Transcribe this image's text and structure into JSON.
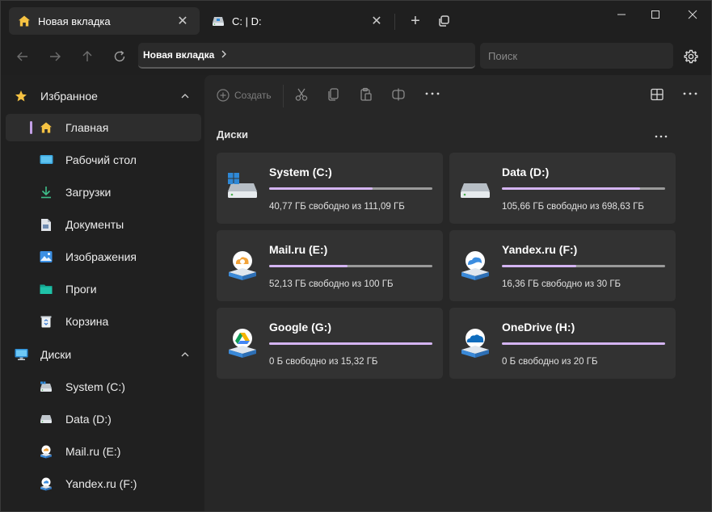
{
  "tabs": [
    {
      "title": "Новая вкладка",
      "icon": "home-icon",
      "active": true
    },
    {
      "title": "C: | D:",
      "icon": "drive-icon",
      "active": false
    }
  ],
  "address": {
    "crumb": "Новая вкладка"
  },
  "search": {
    "placeholder": "Поиск"
  },
  "toolbar": {
    "create_label": "Создать"
  },
  "sidebar": {
    "favorites": {
      "label": "Избранное",
      "items": [
        {
          "label": "Главная",
          "icon": "home-icon"
        },
        {
          "label": "Рабочий стол",
          "icon": "desktop-icon"
        },
        {
          "label": "Загрузки",
          "icon": "download-icon"
        },
        {
          "label": "Документы",
          "icon": "documents-icon"
        },
        {
          "label": "Изображения",
          "icon": "pictures-icon"
        },
        {
          "label": "Проги",
          "icon": "folder-icon"
        },
        {
          "label": "Корзина",
          "icon": "recycle-bin-icon"
        }
      ]
    },
    "drives": {
      "label": "Диски",
      "items": [
        {
          "label": "System (C:)",
          "icon": "system-drive-icon"
        },
        {
          "label": "Data (D:)",
          "icon": "drive-icon"
        },
        {
          "label": "Mail.ru (E:)",
          "icon": "cloud-drive-icon"
        },
        {
          "label": "Yandex.ru (F:)",
          "icon": "cloud-drive-icon"
        }
      ]
    }
  },
  "main": {
    "section_title": "Диски",
    "drives": [
      {
        "name": "System (C:)",
        "free": "40,77 ГБ свободно из 111,09 ГБ",
        "used_fraction": 0.633,
        "icon": "system-drive-icon"
      },
      {
        "name": "Data (D:)",
        "free": "105,66 ГБ свободно из 698,63 ГБ",
        "used_fraction": 0.849,
        "icon": "drive-icon"
      },
      {
        "name": "Mail.ru (E:)",
        "free": "52,13 ГБ свободно из 100 ГБ",
        "used_fraction": 0.479,
        "icon": "mailru-cloud-icon"
      },
      {
        "name": "Yandex.ru (F:)",
        "free": "16,36 ГБ свободно из 30 ГБ",
        "used_fraction": 0.455,
        "icon": "yandex-cloud-icon"
      },
      {
        "name": "Google (G:)",
        "free": "0 Б свободно из 15,32 ГБ",
        "used_fraction": 1.0,
        "icon": "google-drive-icon"
      },
      {
        "name": "OneDrive (H:)",
        "free": "0 Б свободно из 20 ГБ",
        "used_fraction": 1.0,
        "icon": "onedrive-icon"
      }
    ]
  },
  "colors": {
    "accent": "#c3a0e6",
    "bar_fill": "#d4b4f2",
    "home": "#f5c242"
  }
}
